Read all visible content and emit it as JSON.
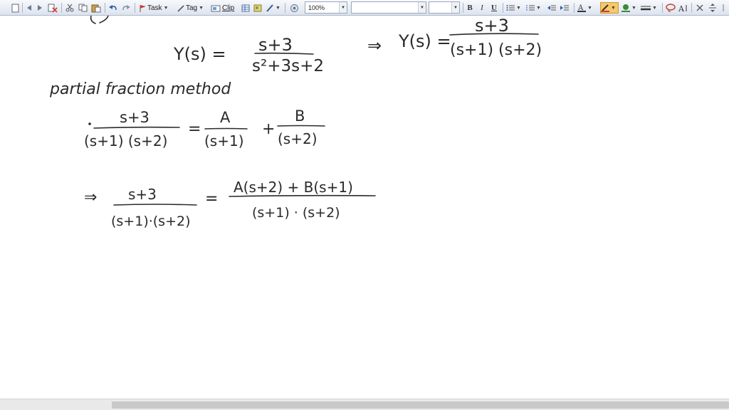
{
  "toolbar": {
    "task_label": "Task",
    "tag_label": "Tag",
    "clip_label": "Clip",
    "zoom_value": "100%",
    "font_name": "",
    "font_size": "",
    "bold_label": "B",
    "italic_label": "I",
    "underline_label": "U",
    "accent": "#d73a2e"
  },
  "notes": {
    "line1_lhs": "Y(s) =",
    "line1_num": "s+3",
    "line1_den": "s²+3s+2",
    "line1_arrow": "⇒",
    "line1_lhs2": "Y(s) =",
    "line1_num2": "s+3",
    "line1_den2": "(s+1) (s+2)",
    "method": "partial fraction method",
    "line3_num": "s+3",
    "line3_den": "(s+1) (s+2)",
    "line3_eq": "=",
    "line3_a": "A",
    "line3_a_den": "(s+1)",
    "line3_plus": "+",
    "line3_b": "B",
    "line3_b_den": "(s+2)",
    "line4_arrow": "⇒",
    "line4_num": "s+3",
    "line4_den": "(s+1)·(s+2)",
    "line4_eq": "=",
    "line4_rnum": "A(s+2) + B(s+1)",
    "line4_rden": "(s+1) · (s+2)"
  }
}
